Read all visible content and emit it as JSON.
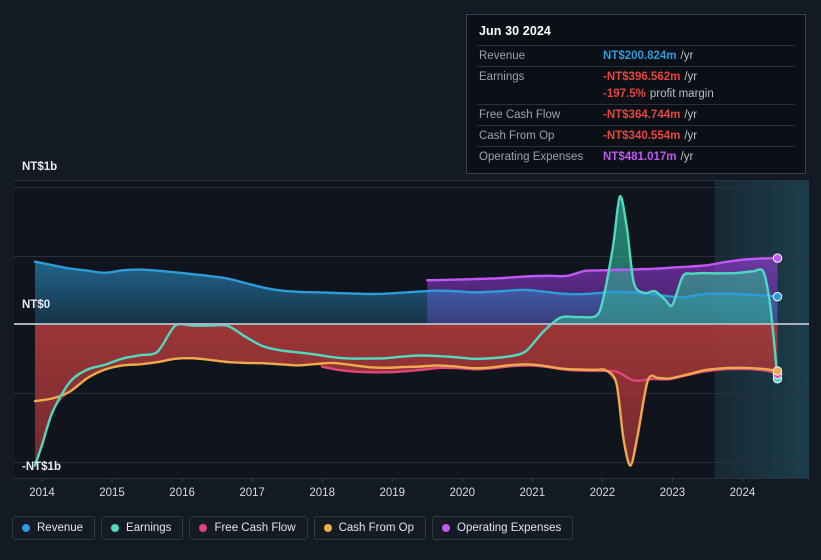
{
  "tooltip": {
    "title": "Jun 30 2024",
    "rows": [
      {
        "label": "Revenue",
        "value": "NT$200.824m",
        "unit": "/yr",
        "color": "#2d9cdb"
      },
      {
        "label": "Earnings",
        "value": "-NT$396.562m",
        "unit": "/yr",
        "color": "#e8453c"
      },
      {
        "label": "",
        "value": "-197.5%",
        "unit": "profit margin",
        "color": "#e8453c",
        "sub": true
      },
      {
        "label": "Free Cash Flow",
        "value": "-NT$364.744m",
        "unit": "/yr",
        "color": "#e8453c"
      },
      {
        "label": "Cash From Op",
        "value": "-NT$340.554m",
        "unit": "/yr",
        "color": "#e8453c"
      },
      {
        "label": "Operating Expenses",
        "value": "NT$481.017m",
        "unit": "/yr",
        "color": "#c158f5"
      }
    ]
  },
  "legend": {
    "items": [
      {
        "label": "Revenue",
        "color": "#2d9cdb"
      },
      {
        "label": "Earnings",
        "color": "#4fd9c0"
      },
      {
        "label": "Free Cash Flow",
        "color": "#e0457b"
      },
      {
        "label": "Cash From Op",
        "color": "#eeab4c"
      },
      {
        "label": "Operating Expenses",
        "color": "#c158f5"
      }
    ]
  },
  "axis": {
    "y_labels": [
      "NT$1b",
      "NT$0",
      "-NT$1b"
    ],
    "x_labels": [
      "2014",
      "2015",
      "2016",
      "2017",
      "2018",
      "2019",
      "2020",
      "2021",
      "2022",
      "2023",
      "2024"
    ]
  },
  "chart_data": {
    "type": "area",
    "title": "",
    "xlabel": "",
    "ylabel": "NT$",
    "ylim": [
      -1.12,
      1.05
    ],
    "xlim": [
      2013.6,
      2024.95
    ],
    "grid": true,
    "legend_position": "bottom",
    "y_ticks": [
      1,
      0,
      -1
    ],
    "y_tick_labels": [
      "NT$1b",
      "NT$0",
      "-NT$1b"
    ],
    "x_ticks": [
      2014,
      2015,
      2016,
      2017,
      2018,
      2019,
      2020,
      2021,
      2022,
      2023,
      2024
    ],
    "currency": "NT$",
    "forecast_band_start": 2023.6,
    "series": [
      {
        "name": "Revenue",
        "color": "#2d9cdb",
        "fill": true,
        "x": [
          2013.9,
          2014.15,
          2014.4,
          2014.65,
          2014.9,
          2015.15,
          2015.4,
          2015.65,
          2015.9,
          2016.15,
          2016.4,
          2016.65,
          2016.9,
          2017.15,
          2017.4,
          2017.65,
          2017.9,
          2018.15,
          2018.4,
          2018.65,
          2018.9,
          2019.15,
          2019.4,
          2019.65,
          2019.9,
          2020.15,
          2020.4,
          2020.65,
          2020.9,
          2021.15,
          2021.4,
          2021.65,
          2021.9,
          2022.15,
          2022.4,
          2022.65,
          2022.9,
          2023.15,
          2023.4,
          2023.65,
          2023.9,
          2024.15,
          2024.4,
          2024.5
        ],
        "y": [
          0.455,
          0.43,
          0.405,
          0.39,
          0.374,
          0.392,
          0.398,
          0.39,
          0.378,
          0.364,
          0.35,
          0.332,
          0.3,
          0.268,
          0.246,
          0.236,
          0.232,
          0.228,
          0.224,
          0.22,
          0.222,
          0.23,
          0.238,
          0.244,
          0.24,
          0.232,
          0.236,
          0.244,
          0.25,
          0.238,
          0.224,
          0.218,
          0.225,
          0.236,
          0.232,
          0.222,
          0.206,
          0.196,
          0.216,
          0.224,
          0.22,
          0.214,
          0.206,
          0.201
        ]
      },
      {
        "name": "Earnings",
        "color": "#4fd9c0",
        "fill": true,
        "x": [
          2013.9,
          2014.0,
          2014.15,
          2014.4,
          2014.65,
          2014.9,
          2015.15,
          2015.4,
          2015.65,
          2015.9,
          2016.15,
          2016.4,
          2016.65,
          2016.9,
          2017.15,
          2017.4,
          2017.65,
          2017.9,
          2018.15,
          2018.4,
          2018.65,
          2018.9,
          2019.15,
          2019.4,
          2019.65,
          2019.9,
          2020.15,
          2020.4,
          2020.65,
          2020.9,
          2021.15,
          2021.4,
          2021.65,
          2021.9,
          2022.0,
          2022.15,
          2022.25,
          2022.35,
          2022.45,
          2022.6,
          2022.75,
          2022.9,
          2023.0,
          2023.15,
          2023.3,
          2023.45,
          2023.6,
          2023.9,
          2024.15,
          2024.3,
          2024.4,
          2024.5
        ],
        "y": [
          -1.03,
          -0.88,
          -0.64,
          -0.42,
          -0.33,
          -0.295,
          -0.25,
          -0.226,
          -0.2,
          -0.012,
          -0.01,
          -0.01,
          -0.012,
          -0.09,
          -0.16,
          -0.19,
          -0.205,
          -0.22,
          -0.24,
          -0.25,
          -0.25,
          -0.248,
          -0.236,
          -0.228,
          -0.232,
          -0.24,
          -0.252,
          -0.248,
          -0.236,
          -0.2,
          -0.058,
          0.048,
          0.052,
          0.058,
          0.16,
          0.56,
          0.93,
          0.7,
          0.3,
          0.228,
          0.24,
          0.176,
          0.14,
          0.35,
          0.368,
          0.372,
          0.37,
          0.372,
          0.385,
          0.38,
          0.12,
          -0.397
        ]
      },
      {
        "name": "Free Cash Flow",
        "color": "#e0457b",
        "fill": false,
        "x": [
          2018.0,
          2018.2,
          2018.45,
          2018.7,
          2018.95,
          2019.2,
          2019.45,
          2019.7,
          2019.95,
          2020.2,
          2020.45,
          2020.7,
          2020.95,
          2021.2,
          2021.45,
          2021.7,
          2021.95,
          2022.2,
          2022.45,
          2022.7,
          2022.95,
          2023.2,
          2023.45,
          2023.7,
          2023.95,
          2024.2,
          2024.4,
          2024.5
        ],
        "y": [
          -0.31,
          -0.33,
          -0.345,
          -0.35,
          -0.35,
          -0.342,
          -0.33,
          -0.318,
          -0.32,
          -0.328,
          -0.32,
          -0.306,
          -0.3,
          -0.31,
          -0.33,
          -0.338,
          -0.34,
          -0.345,
          -0.41,
          -0.4,
          -0.4,
          -0.372,
          -0.345,
          -0.33,
          -0.326,
          -0.33,
          -0.345,
          -0.365
        ]
      },
      {
        "name": "Cash From Op",
        "color": "#eeab4c",
        "fill": false,
        "x": [
          2013.9,
          2014.15,
          2014.4,
          2014.65,
          2014.9,
          2015.15,
          2015.4,
          2015.65,
          2015.9,
          2016.15,
          2016.4,
          2016.65,
          2016.9,
          2017.15,
          2017.4,
          2017.65,
          2017.9,
          2018.15,
          2018.4,
          2018.65,
          2018.9,
          2019.15,
          2019.4,
          2019.65,
          2019.9,
          2020.15,
          2020.4,
          2020.65,
          2020.9,
          2021.15,
          2021.4,
          2021.65,
          2021.9,
          2022.05,
          2022.2,
          2022.3,
          2022.4,
          2022.5,
          2022.65,
          2022.8,
          2022.95,
          2023.2,
          2023.45,
          2023.7,
          2023.95,
          2024.2,
          2024.4,
          2024.5
        ],
        "y": [
          -0.56,
          -0.54,
          -0.49,
          -0.392,
          -0.33,
          -0.3,
          -0.292,
          -0.276,
          -0.252,
          -0.248,
          -0.26,
          -0.276,
          -0.282,
          -0.284,
          -0.292,
          -0.3,
          -0.29,
          -0.282,
          -0.296,
          -0.312,
          -0.318,
          -0.312,
          -0.308,
          -0.3,
          -0.308,
          -0.32,
          -0.316,
          -0.3,
          -0.292,
          -0.302,
          -0.322,
          -0.33,
          -0.332,
          -0.336,
          -0.43,
          -0.83,
          -1.03,
          -0.82,
          -0.408,
          -0.392,
          -0.396,
          -0.368,
          -0.336,
          -0.322,
          -0.318,
          -0.322,
          -0.332,
          -0.341
        ]
      },
      {
        "name": "Operating Expenses",
        "color": "#c158f5",
        "fill": true,
        "x": [
          2019.5,
          2019.75,
          2020.0,
          2020.25,
          2020.5,
          2020.75,
          2021.0,
          2021.25,
          2021.5,
          2021.75,
          2022.0,
          2022.25,
          2022.5,
          2022.75,
          2023.0,
          2023.25,
          2023.5,
          2023.75,
          2024.0,
          2024.25,
          2024.4,
          2024.5
        ],
        "y": [
          0.32,
          0.322,
          0.326,
          0.33,
          0.334,
          0.342,
          0.35,
          0.352,
          0.352,
          0.388,
          0.392,
          0.396,
          0.4,
          0.404,
          0.412,
          0.42,
          0.43,
          0.452,
          0.47,
          0.478,
          0.48,
          0.481
        ]
      }
    ]
  }
}
